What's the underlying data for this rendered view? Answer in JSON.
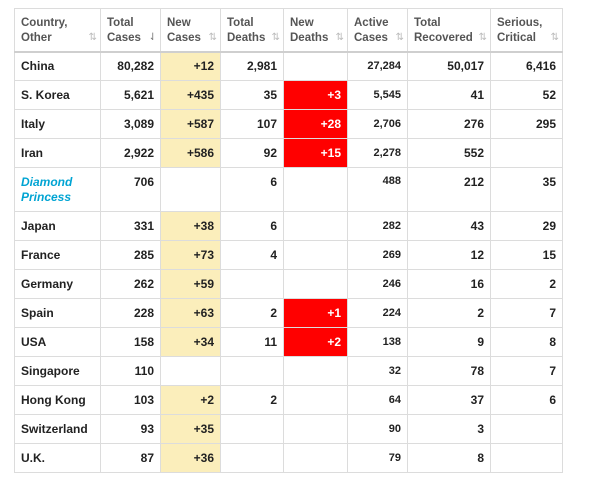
{
  "headers": [
    {
      "line1": "Country,",
      "line2": "Other",
      "sort": "⇅",
      "active": false
    },
    {
      "line1": "Total",
      "line2": "Cases",
      "sort": "⇃",
      "active": true
    },
    {
      "line1": "New",
      "line2": "Cases",
      "sort": "⇅",
      "active": false
    },
    {
      "line1": "Total",
      "line2": "Deaths",
      "sort": "⇅",
      "active": false
    },
    {
      "line1": "New",
      "line2": "Deaths",
      "sort": "⇅",
      "active": false
    },
    {
      "line1": "Active",
      "line2": "Cases",
      "sort": "⇅",
      "active": false
    },
    {
      "line1": "Total",
      "line2": "Recovered",
      "sort": "⇅",
      "active": false
    },
    {
      "line1": "Serious,",
      "line2": "Critical",
      "sort": "⇅",
      "active": false
    }
  ],
  "rows": [
    {
      "country": "China",
      "total_cases": "80,282",
      "new_cases": "+12",
      "total_deaths": "2,981",
      "new_deaths": "",
      "active_cases": "27,284",
      "total_recovered": "50,017",
      "serious_critical": "6,416",
      "highlight": false
    },
    {
      "country": "S. Korea",
      "total_cases": "5,621",
      "new_cases": "+435",
      "total_deaths": "35",
      "new_deaths": "+3",
      "active_cases": "5,545",
      "total_recovered": "41",
      "serious_critical": "52",
      "highlight": false
    },
    {
      "country": "Italy",
      "total_cases": "3,089",
      "new_cases": "+587",
      "total_deaths": "107",
      "new_deaths": "+28",
      "active_cases": "2,706",
      "total_recovered": "276",
      "serious_critical": "295",
      "highlight": false
    },
    {
      "country": "Iran",
      "total_cases": "2,922",
      "new_cases": "+586",
      "total_deaths": "92",
      "new_deaths": "+15",
      "active_cases": "2,278",
      "total_recovered": "552",
      "serious_critical": "",
      "highlight": false
    },
    {
      "country": "Diamond Princess",
      "total_cases": "706",
      "new_cases": "",
      "total_deaths": "6",
      "new_deaths": "",
      "active_cases": "488",
      "total_recovered": "212",
      "serious_critical": "35",
      "highlight": true
    },
    {
      "country": "Japan",
      "total_cases": "331",
      "new_cases": "+38",
      "total_deaths": "6",
      "new_deaths": "",
      "active_cases": "282",
      "total_recovered": "43",
      "serious_critical": "29",
      "highlight": false
    },
    {
      "country": "France",
      "total_cases": "285",
      "new_cases": "+73",
      "total_deaths": "4",
      "new_deaths": "",
      "active_cases": "269",
      "total_recovered": "12",
      "serious_critical": "15",
      "highlight": false
    },
    {
      "country": "Germany",
      "total_cases": "262",
      "new_cases": "+59",
      "total_deaths": "",
      "new_deaths": "",
      "active_cases": "246",
      "total_recovered": "16",
      "serious_critical": "2",
      "highlight": false
    },
    {
      "country": "Spain",
      "total_cases": "228",
      "new_cases": "+63",
      "total_deaths": "2",
      "new_deaths": "+1",
      "active_cases": "224",
      "total_recovered": "2",
      "serious_critical": "7",
      "highlight": false
    },
    {
      "country": "USA",
      "total_cases": "158",
      "new_cases": "+34",
      "total_deaths": "11",
      "new_deaths": "+2",
      "active_cases": "138",
      "total_recovered": "9",
      "serious_critical": "8",
      "highlight": false
    },
    {
      "country": "Singapore",
      "total_cases": "110",
      "new_cases": "",
      "total_deaths": "",
      "new_deaths": "",
      "active_cases": "32",
      "total_recovered": "78",
      "serious_critical": "7",
      "highlight": false
    },
    {
      "country": "Hong Kong",
      "total_cases": "103",
      "new_cases": "+2",
      "total_deaths": "2",
      "new_deaths": "",
      "active_cases": "64",
      "total_recovered": "37",
      "serious_critical": "6",
      "highlight": false
    },
    {
      "country": "Switzerland",
      "total_cases": "93",
      "new_cases": "+35",
      "total_deaths": "",
      "new_deaths": "",
      "active_cases": "90",
      "total_recovered": "3",
      "serious_critical": "",
      "highlight": false
    },
    {
      "country": "U.K.",
      "total_cases": "87",
      "new_cases": "+36",
      "total_deaths": "",
      "new_deaths": "",
      "active_cases": "79",
      "total_recovered": "8",
      "serious_critical": "",
      "highlight": false
    }
  ],
  "colors": {
    "new_cases_fill": "#fbeebb",
    "new_deaths_fill": "#ff0000",
    "highlight_text": "#00a4d3"
  }
}
